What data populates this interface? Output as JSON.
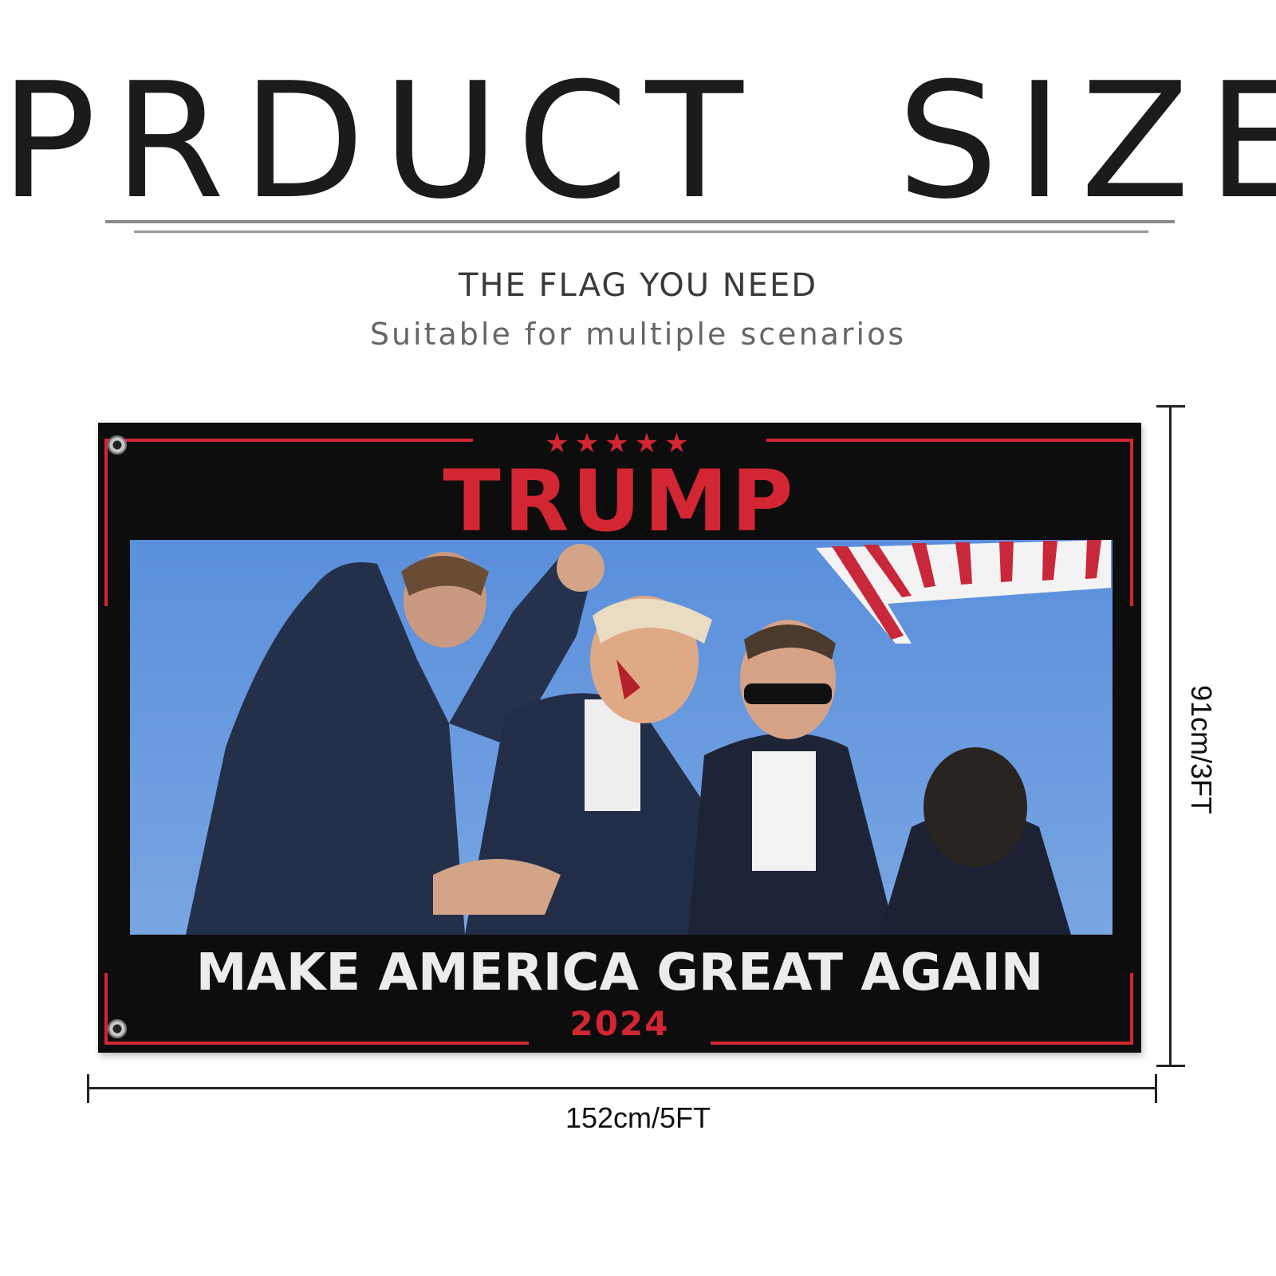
{
  "header": {
    "title": "PRDUCT  SIZE"
  },
  "intro": {
    "tagline": "THE FLAG YOU NEED",
    "subtagline": "Suitable for multiple scenarios"
  },
  "flag": {
    "stars": "★★★★★",
    "name": "TRUMP",
    "slogan": "MAKE AMERICA GREAT AGAIN",
    "year": "2024",
    "colors": {
      "background": "#0d0d0d",
      "accent_red": "#d32633",
      "slogan_white": "#ececec",
      "sky_blue": "#5b8fd8"
    }
  },
  "dimensions": {
    "height_label": "91cm/3FT",
    "width_label": "152cm/5FT"
  }
}
